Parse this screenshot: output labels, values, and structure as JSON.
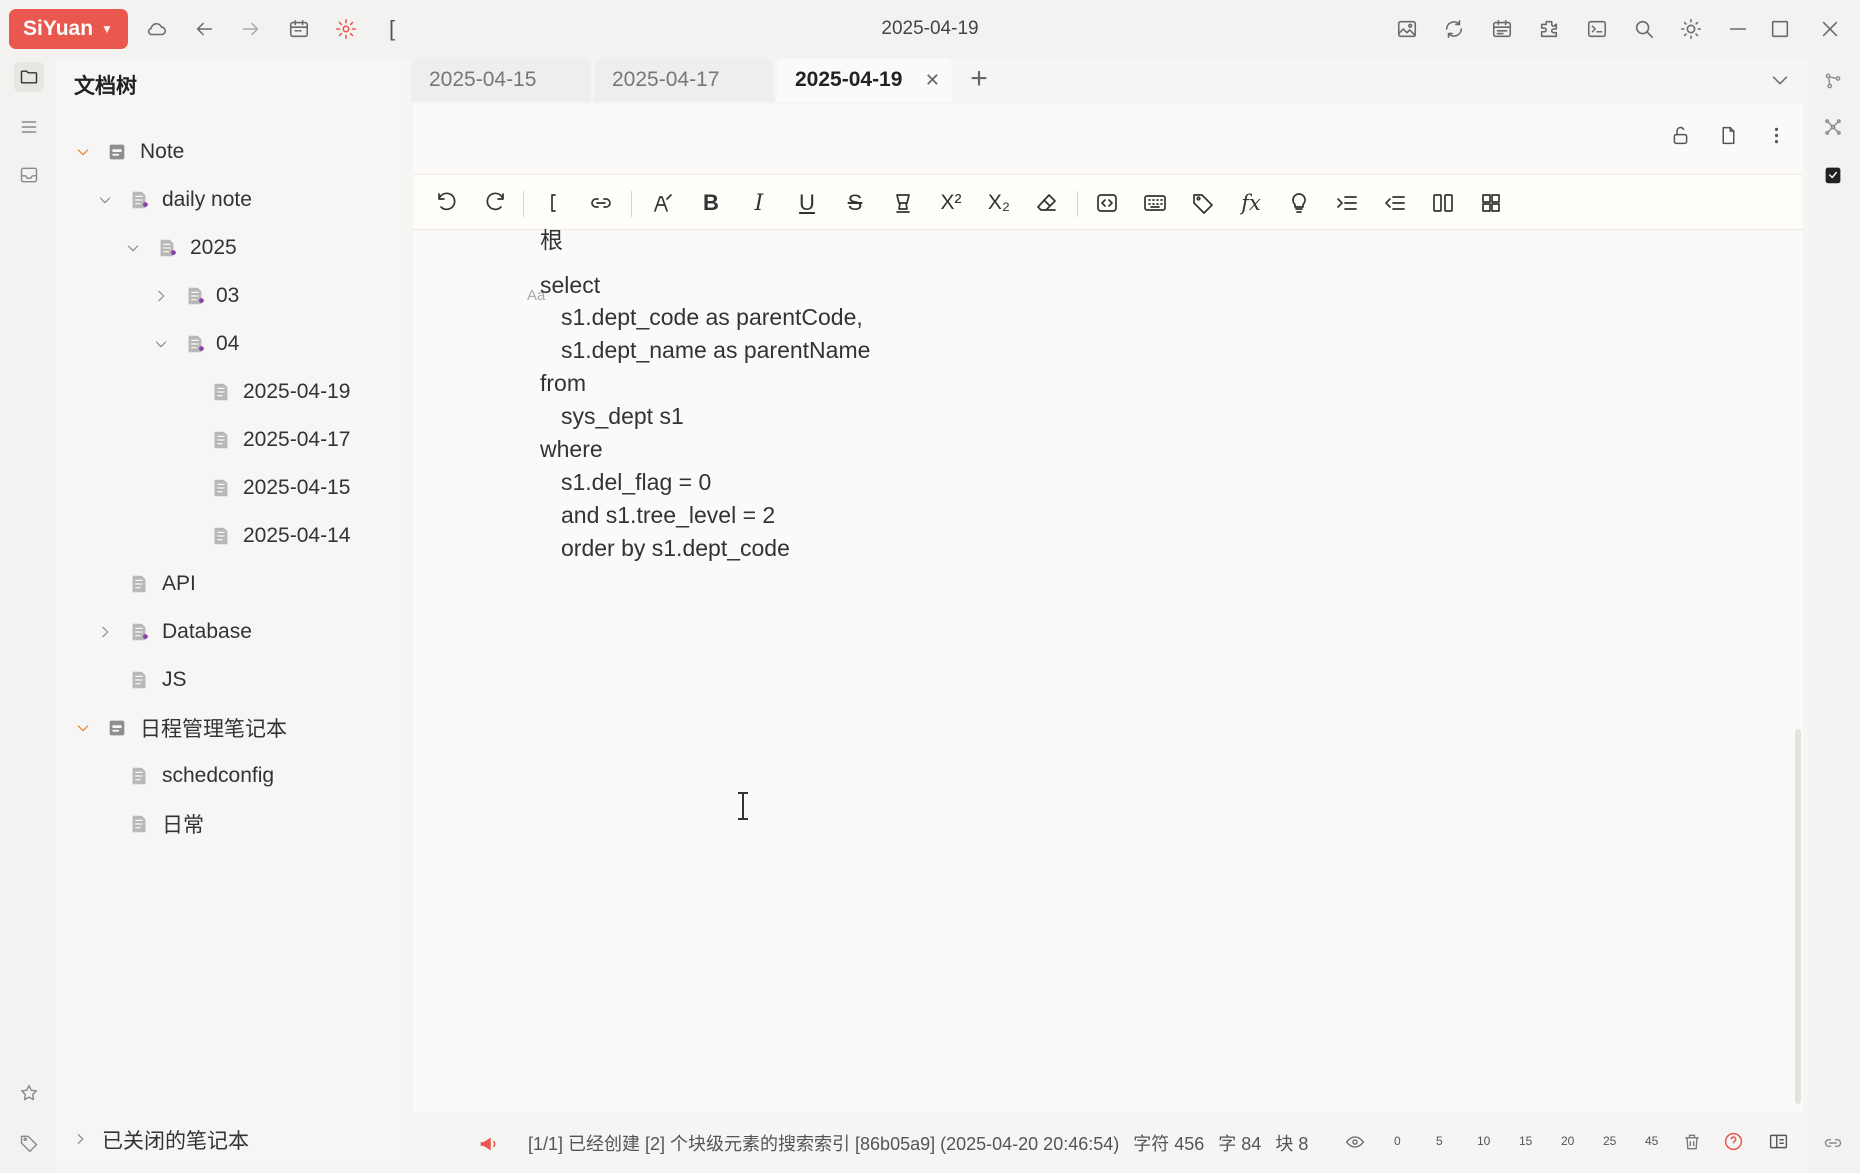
{
  "app": {
    "brand": "SiYuan",
    "window_title": "2025-04-19"
  },
  "titlebar": {
    "left_icons": [
      "cloud-icon",
      "back-icon",
      "forward-icon",
      "calendar-icon",
      "settings-icon",
      "bracket-icon"
    ],
    "bracket_text": "[",
    "right_icons": [
      "image-icon",
      "sync-icon",
      "calendar-grid-icon",
      "plugin-icon",
      "terminal-icon",
      "search-icon",
      "theme-icon",
      "minimize-icon",
      "maximize-icon",
      "close-icon"
    ]
  },
  "tree": {
    "title": "文档树",
    "items": [
      {
        "label": "Note",
        "expanded": true
      },
      {
        "label": "daily note",
        "expanded": true
      },
      {
        "label": "2025",
        "expanded": true
      },
      {
        "label": "03",
        "expanded": false
      },
      {
        "label": "04",
        "expanded": true
      },
      {
        "label": "2025-04-19"
      },
      {
        "label": "2025-04-17"
      },
      {
        "label": "2025-04-15"
      },
      {
        "label": "2025-04-14"
      },
      {
        "label": "API"
      },
      {
        "label": "Database",
        "expanded": false
      },
      {
        "label": "JS"
      },
      {
        "label": "日程管理笔记本",
        "expanded": true
      },
      {
        "label": "schedconfig"
      },
      {
        "label": "日常"
      }
    ],
    "closed_notebooks": "已关闭的笔记本"
  },
  "tabs": [
    {
      "label": "2025-04-15",
      "active": false
    },
    {
      "label": "2025-04-17",
      "active": false
    },
    {
      "label": "2025-04-19",
      "active": true
    }
  ],
  "editor": {
    "lines": [
      "根",
      "select",
      "  s1.dept_code as parentCode,",
      "  s1.dept_name as parentName",
      "from",
      "  sys_dept s1",
      "where",
      "  s1.del_flag = 0",
      "  and s1.tree_level = 2",
      "  order by s1.dept_code"
    ],
    "block_marker": "Aa"
  },
  "status": {
    "message": "[1/1] 已经创建 [2] 个块级元素的搜索索引 [86b05a9] (2025-04-20 20:46:54)",
    "chars": "字符 456",
    "words": "字 84",
    "blocks": "块 8",
    "zoom_marks": [
      "0",
      "5",
      "10",
      "15",
      "20",
      "25",
      "45"
    ]
  },
  "colors": {
    "brand": "#e9574f",
    "accent_orange": "#e0812c",
    "background": "#f6f5f3"
  }
}
